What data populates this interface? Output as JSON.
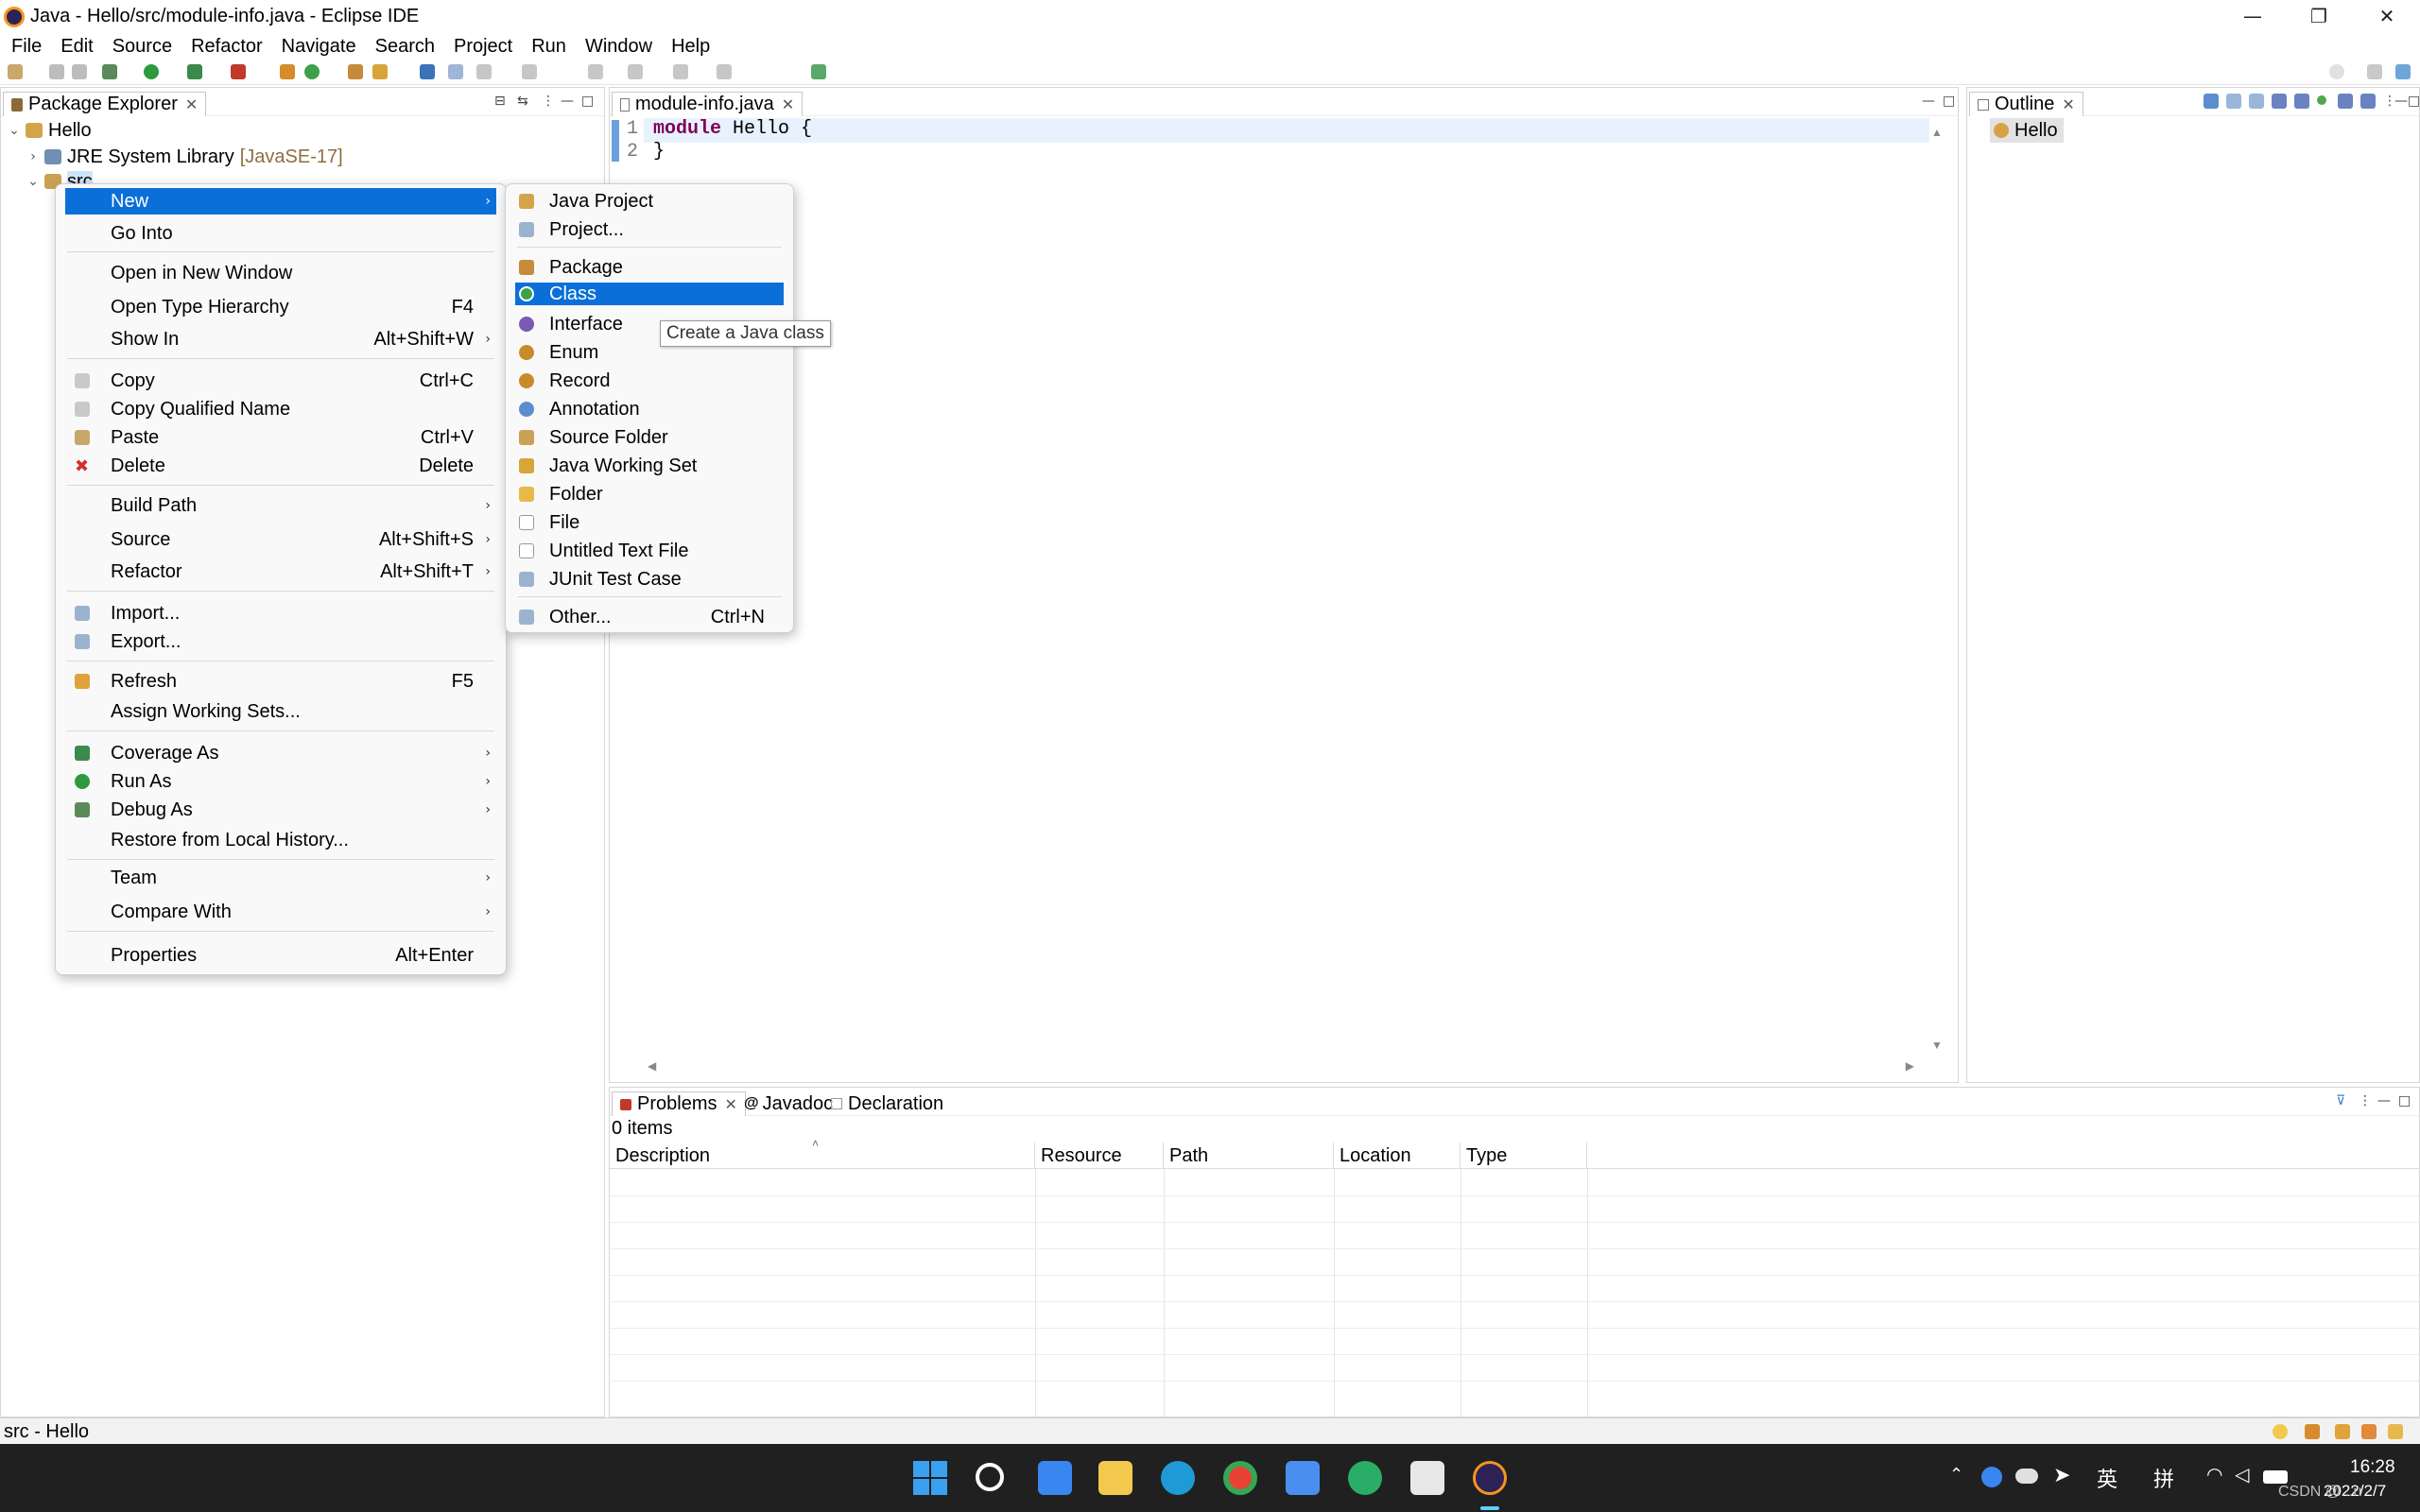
{
  "window": {
    "title": "Java - Hello/src/module-info.java - Eclipse IDE",
    "minimize": "—",
    "restore": "❐",
    "close": "✕"
  },
  "menubar": [
    "File",
    "Edit",
    "Source",
    "Refactor",
    "Navigate",
    "Search",
    "Project",
    "Run",
    "Window",
    "Help"
  ],
  "package_explorer": {
    "tab_label": "Package Explorer",
    "tree": {
      "project": "Hello",
      "jre": "JRE System Library",
      "jre_version": "[JavaSE-17]",
      "src": "src"
    }
  },
  "editor": {
    "tab_label": "module-info.java",
    "lines": [
      {
        "num": "1",
        "keyword": "module",
        "rest": " Hello {"
      },
      {
        "num": "2",
        "keyword": "",
        "rest": "}"
      }
    ]
  },
  "outline": {
    "tab_label": "Outline",
    "item": "Hello"
  },
  "bottom_panel": {
    "tabs": [
      "Problems",
      "Javadoc",
      "Declaration"
    ],
    "count": "0 items",
    "columns": [
      "Description",
      "Resource",
      "Path",
      "Location",
      "Type"
    ]
  },
  "context_menu": {
    "new": "New",
    "go_into": "Go Into",
    "open_new_window": "Open in New Window",
    "open_type_hierarchy": "Open Type Hierarchy",
    "open_type_hierarchy_key": "F4",
    "show_in": "Show In",
    "show_in_key": "Alt+Shift+W",
    "copy": "Copy",
    "copy_key": "Ctrl+C",
    "copy_qualified": "Copy Qualified Name",
    "paste": "Paste",
    "paste_key": "Ctrl+V",
    "delete": "Delete",
    "delete_key": "Delete",
    "build_path": "Build Path",
    "source": "Source",
    "source_key": "Alt+Shift+S",
    "refactor": "Refactor",
    "refactor_key": "Alt+Shift+T",
    "import": "Import...",
    "export": "Export...",
    "refresh": "Refresh",
    "refresh_key": "F5",
    "assign_ws": "Assign Working Sets...",
    "coverage_as": "Coverage As",
    "run_as": "Run As",
    "debug_as": "Debug As",
    "restore_history": "Restore from Local History...",
    "team": "Team",
    "compare_with": "Compare With",
    "properties": "Properties",
    "properties_key": "Alt+Enter"
  },
  "submenu_new": {
    "java_project": "Java Project",
    "project": "Project...",
    "package": "Package",
    "class": "Class",
    "interface": "Interface",
    "enum": "Enum",
    "record": "Record",
    "annotation": "Annotation",
    "source_folder": "Source Folder",
    "java_working_set": "Java Working Set",
    "folder": "Folder",
    "file": "File",
    "untitled_text": "Untitled Text File",
    "junit": "JUnit Test Case",
    "other": "Other...",
    "other_key": "Ctrl+N"
  },
  "tooltip": "Create a Java class",
  "statusbar": {
    "text": "src - Hello"
  },
  "taskbar": {
    "time": "16:28",
    "date": "2022/2/7",
    "ime1": "英",
    "ime2": "拼",
    "watermark": "CSDN @...rr"
  },
  "colors": {
    "selection": "#0a6fd9",
    "keyword": "#7f0055",
    "jre_version": "#8d6e3f"
  }
}
